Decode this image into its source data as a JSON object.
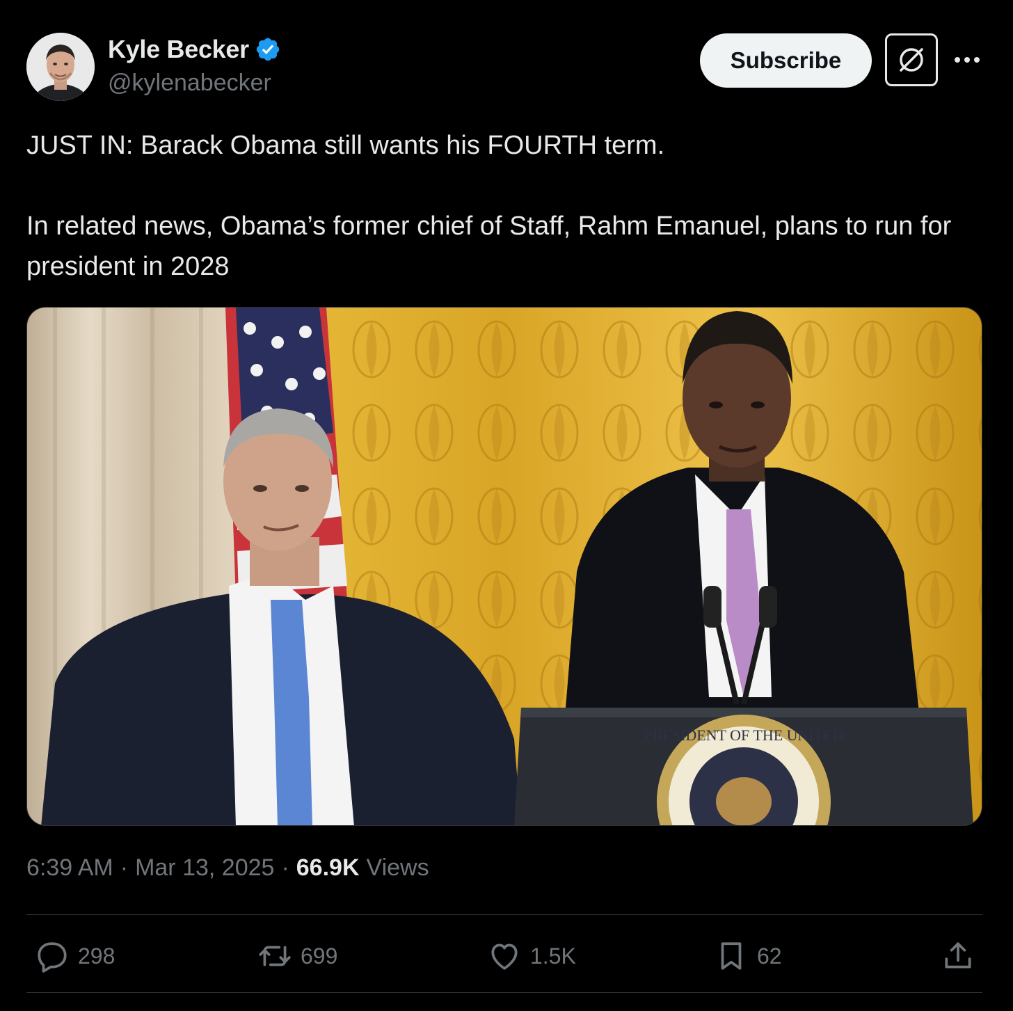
{
  "author": {
    "display_name": "Kyle Becker",
    "handle": "@kylenabecker",
    "verified": true,
    "avatar_icon": "profile-photo"
  },
  "header_actions": {
    "subscribe_label": "Subscribe",
    "grok_icon": "grok-icon",
    "more_icon": "more-icon"
  },
  "tweet": {
    "text_line1": "JUST IN: Barack Obama still wants his FOURTH term.",
    "text_line2": "In related news, Obama’s former chief of Staff, Rahm Emanuel, plans to run for president in 2028"
  },
  "media": {
    "type": "photo",
    "seal_text": "PRESIDENT OF THE UNITED"
  },
  "meta": {
    "time": "6:39 AM",
    "date": "Mar 13, 2025",
    "separator": "·",
    "views_count": "66.9K",
    "views_label": "Views"
  },
  "actions": {
    "replies": "298",
    "reposts": "699",
    "likes": "1.5K",
    "bookmarks": "62"
  },
  "colors": {
    "background": "#000000",
    "text_primary": "#e7e9ea",
    "text_secondary": "#71767b",
    "verified_blue": "#1d9bf0",
    "divider": "#2f3336"
  }
}
